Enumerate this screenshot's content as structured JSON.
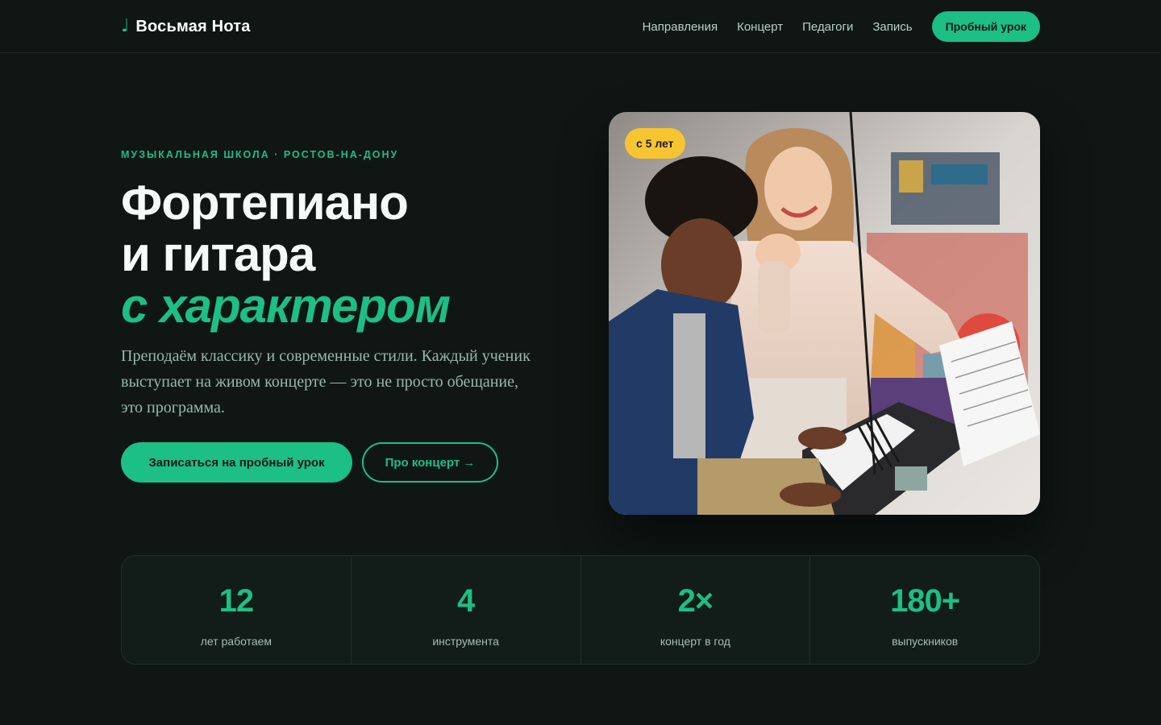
{
  "header": {
    "logo_icon": "♩",
    "logo_text": "Восьмая Нота",
    "nav": [
      "Направления",
      "Концерт",
      "Педагоги",
      "Запись"
    ],
    "cta": "Пробный урок"
  },
  "hero": {
    "eyebrow": "МУЗЫКАЛЬНАЯ ШКОЛА · РОСТОВ-НА-ДОНУ",
    "title_line1": "Фортепиано",
    "title_line2": "и гитара",
    "title_accent": "с характером",
    "lead": "Преподаём классику и современные стили. Каждый ученик выступает на живом концерте — это не просто обещание, это программа.",
    "primary_button": "Записаться на пробный урок",
    "secondary_button": "Про концерт →",
    "badge": "с 5 лет",
    "photo_icon": "teacher-and-student-at-piano-photo"
  },
  "stats": [
    {
      "value": "12",
      "label": "лет работаем"
    },
    {
      "value": "4",
      "label": "инструмента"
    },
    {
      "value": "2×",
      "label": "концерт в год"
    },
    {
      "value": "180+",
      "label": "выпускников"
    }
  ],
  "colors": {
    "background": "#0f1614",
    "accent": "#1cbf85",
    "badge": "#f7c531"
  }
}
